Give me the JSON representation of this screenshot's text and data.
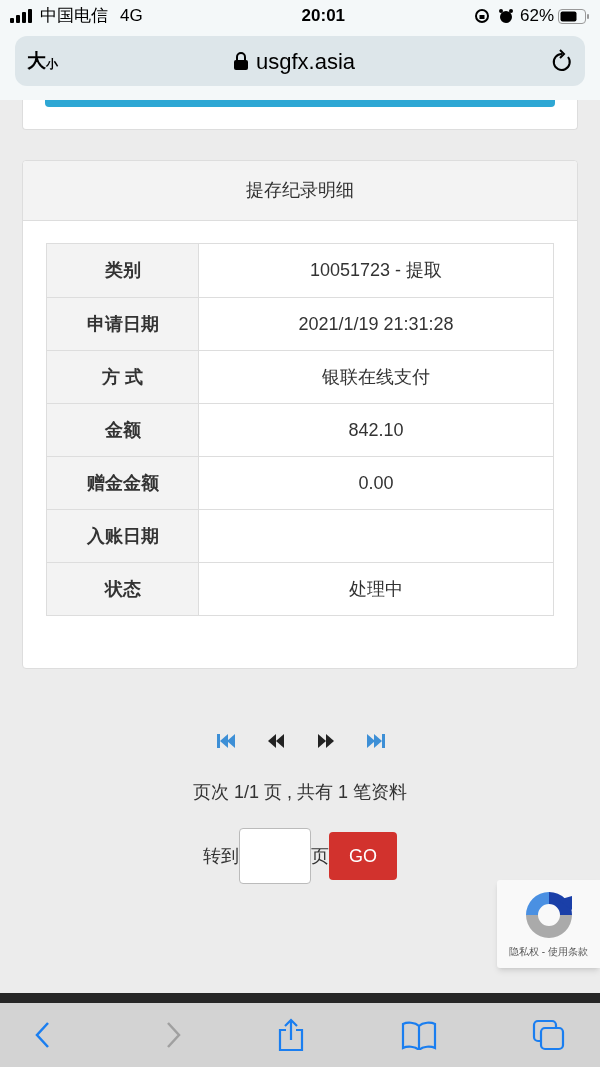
{
  "status_bar": {
    "carrier": "中国电信",
    "network": "4G",
    "time": "20:01",
    "battery": "62%"
  },
  "address_bar": {
    "text_size_big": "大",
    "text_size_small": "小",
    "url": "usgfx.asia"
  },
  "record_card": {
    "title": "提存纪录明细",
    "rows": [
      {
        "label": "类别",
        "value": "10051723 - 提取"
      },
      {
        "label": "申请日期",
        "value": "2021/1/19 21:31:28"
      },
      {
        "label": "方 式",
        "value": "银联在线支付"
      },
      {
        "label": "金额",
        "value": "842.10"
      },
      {
        "label": "赠金金额",
        "value": "0.00"
      },
      {
        "label": "入账日期"
      },
      {
        "label": "状态",
        "value": "处理中"
      }
    ]
  },
  "pagination": {
    "summary": "页次 1/1 页 , 共有 1 笔资料",
    "jump_label": "转到",
    "page_unit": "页",
    "go_button": "GO"
  },
  "recaptcha": {
    "links": "隐私权 - 使用条款"
  },
  "toolbar": {
    "back_disabled": false,
    "forward_disabled": true
  }
}
